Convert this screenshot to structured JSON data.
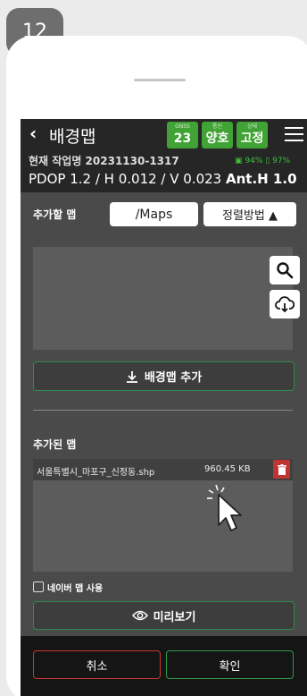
{
  "step": "12",
  "header": {
    "title": "배경맵",
    "status": [
      {
        "small": "GNSS",
        "big": "23"
      },
      {
        "small": "통신",
        "big": "양호"
      },
      {
        "small": "상태",
        "big": "고정"
      }
    ]
  },
  "job": {
    "label": "현재 작업명 20231130-1317",
    "battery_a": "94%",
    "battery_b": "97%"
  },
  "pdop": {
    "text": "PDOP 1.2 / H 0.012 / V 0.023",
    "ant_label": "Ant.H 1.0"
  },
  "add_section": {
    "label": "추가할 맵",
    "path": "/Maps",
    "sort_label": "정렬방법 ▲",
    "add_button": "배경맵 추가"
  },
  "added_section": {
    "label": "추가된 맵",
    "files": [
      {
        "name": "서울특별시_마포구_신정동.shp",
        "size": "960.45 KB"
      }
    ]
  },
  "naver_label": "네이버 맵 사용",
  "preview_label": "미리보기",
  "footer": {
    "cancel": "취소",
    "ok": "확인"
  },
  "colors": {
    "accent_green": "#41a235",
    "danger_red": "#c13434"
  }
}
